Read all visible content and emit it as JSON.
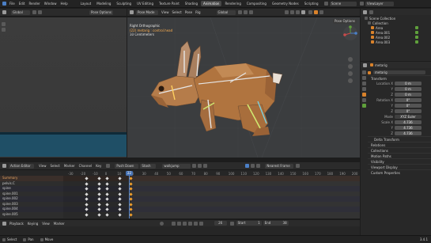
{
  "topbar": {
    "menus": [
      "File",
      "Edit",
      "Render",
      "Window",
      "Help"
    ],
    "tabs": [
      "Layout",
      "Modeling",
      "Sculpting",
      "UV Editing",
      "Texture Paint",
      "Shading",
      "Animation",
      "Rendering",
      "Compositing",
      "Geometry Nodes",
      "Scripting"
    ],
    "active_tab": "Animation",
    "scene": "Scene",
    "view_layer": "ViewLayer"
  },
  "left_viewport": {
    "orientation": "Global",
    "mode": "Pose Options"
  },
  "main_viewport": {
    "mode": "Pose Mode",
    "menus": [
      "View",
      "Select",
      "Pose",
      "Rig"
    ],
    "orientation": "Global",
    "pose_options": "Pose Options",
    "overlay_title": "Right Orthographic",
    "overlay_object": "(22) metarig : control.head",
    "overlay_units": "10 Centimeters"
  },
  "outliner": {
    "title": "Scene Collection",
    "items": [
      "Collection",
      "Area",
      "Area.001",
      "Area.002",
      "Area.003"
    ]
  },
  "properties": {
    "object_name": "metarig",
    "object_name2": "metarig",
    "transform_label": "Transform",
    "location_label": "Location X",
    "location": [
      "0 m",
      "0 m",
      "0 m"
    ],
    "rotation_label": "Rotation X",
    "rotation": [
      "0°",
      "0°",
      "0°"
    ],
    "mode_label": "Mode",
    "mode_value": "XYZ Euler",
    "scale_label": "Scale X",
    "scale": [
      "4.736",
      "4.736",
      "4.736"
    ],
    "axis_y": "Y",
    "axis_z": "Z",
    "sections": [
      "Delta Transform",
      "Relations",
      "Collections",
      "Motion Paths",
      "Visibility",
      "Viewport Display",
      "Custom Properties"
    ]
  },
  "dopesheet": {
    "editor": "Action Editor",
    "menus": [
      "View",
      "Select",
      "Marker",
      "Channel",
      "Key"
    ],
    "push_down": "Push Down",
    "stash": "Stash",
    "action": "walkjump",
    "snap": "Nearest Frame",
    "channels": [
      "Summary",
      "pelvis.C",
      "spine",
      "spine.001",
      "spine.002",
      "spine.003",
      "spine.004",
      "spine.005"
    ],
    "ruler": [
      "-30",
      "-20",
      "-10",
      "0",
      "10",
      "20",
      "30",
      "40",
      "50",
      "60",
      "70",
      "80",
      "90",
      "100",
      "110",
      "120",
      "130",
      "140",
      "150",
      "160",
      "170",
      "180",
      "190",
      "200"
    ],
    "current_frame": "22"
  },
  "timeline": {
    "menus": [
      "Playback",
      "Keying",
      "View",
      "Marker"
    ],
    "current_frame": "26",
    "start_label": "Start",
    "start": "1",
    "end_label": "End",
    "end": "38"
  },
  "statusbar": {
    "items": [
      "Select",
      "Pan",
      "Move"
    ],
    "version": "3.4.1"
  }
}
